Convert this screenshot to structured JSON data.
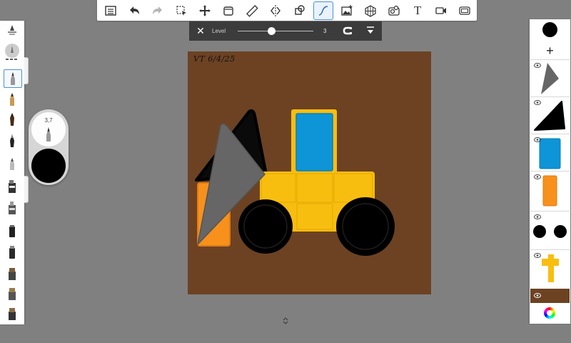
{
  "toolbar": {
    "items": [
      {
        "name": "menu-list-icon"
      },
      {
        "name": "undo-icon"
      },
      {
        "name": "redo-icon"
      },
      {
        "name": "selection-icon"
      },
      {
        "name": "transform-move-icon"
      },
      {
        "name": "layer-stack-icon"
      },
      {
        "name": "ruler-icon"
      },
      {
        "name": "symmetry-icon"
      },
      {
        "name": "shapes-icon"
      },
      {
        "name": "curve-stroke-icon"
      },
      {
        "name": "add-image-icon"
      },
      {
        "name": "perspective-grid-icon"
      },
      {
        "name": "predictive-stroke-icon"
      },
      {
        "name": "text-icon"
      },
      {
        "name": "video-record-icon"
      },
      {
        "name": "fullscreen-icon"
      }
    ],
    "active": "curve-stroke-icon",
    "text_label": "T"
  },
  "levelbar": {
    "close": "✕",
    "label": "Level",
    "value": "3",
    "slider_fraction": 0.45
  },
  "brush": {
    "size": "3,7",
    "color": "#000000"
  },
  "canvas": {
    "signature": "VT 6/4/25",
    "background": "#6c4223"
  },
  "layers": {
    "add_label": "+",
    "current_color": "#000000"
  },
  "colors": {
    "yellow": "#f8be0f",
    "blue": "#0d95d8",
    "orange": "#f7911c",
    "gray_shovel": "#666666",
    "accent": "#4a90d9"
  }
}
